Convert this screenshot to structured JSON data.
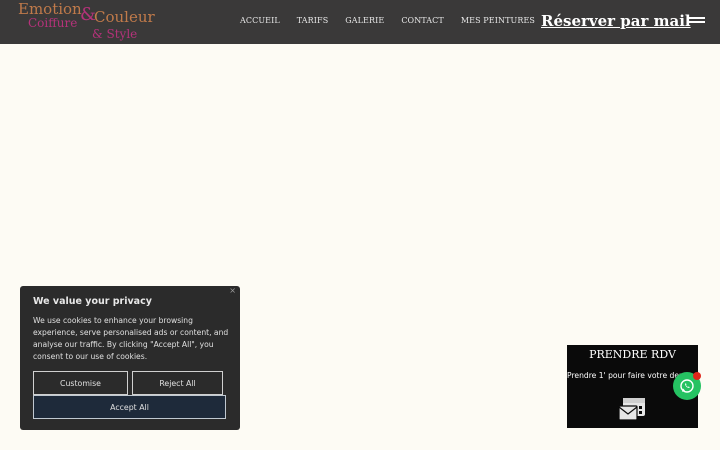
{
  "brand": {
    "line1": "Emotion",
    "line2": "Coiffure",
    "line3": "Couleur",
    "line4": "& Style"
  },
  "nav": {
    "items": [
      "ACCUEIL",
      "TARIFS",
      "GALERIE",
      "CONTACT",
      "MES PEINTURES"
    ]
  },
  "header": {
    "reserve_label": "Réserver par mail"
  },
  "cookie": {
    "close": "×",
    "title": "We value your privacy",
    "text": "We use cookies to enhance your browsing experience, serve personalised ads or content, and analyse our traffic. By clicking \"Accept All\", you consent to our use of cookies.",
    "customise_label": "Customise",
    "reject_label": "Reject All",
    "accept_label": "Accept All"
  },
  "rdv": {
    "title": "PRENDRE RDV",
    "text": "Prendre 1' pour faire votre dem"
  },
  "colors": {
    "header_bg": "#3a3939",
    "page_bg": "#fdfbf4",
    "whatsapp": "#25c262"
  }
}
